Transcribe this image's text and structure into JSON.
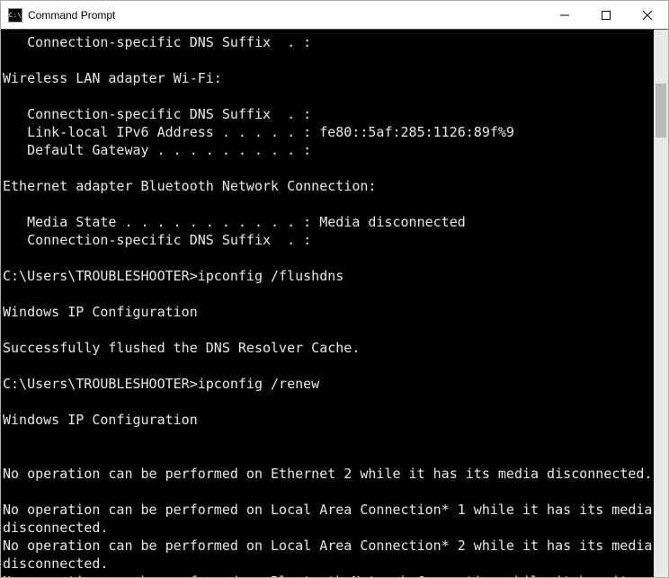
{
  "window": {
    "title": "Command Prompt",
    "icon_label": "C:\\"
  },
  "console": {
    "lines": [
      "   Connection-specific DNS Suffix  . :",
      "",
      "Wireless LAN adapter Wi-Fi:",
      "",
      "   Connection-specific DNS Suffix  . :",
      "   Link-local IPv6 Address . . . . . : fe80::5af:285:1126:89f%9",
      "   Default Gateway . . . . . . . . . :",
      "",
      "Ethernet adapter Bluetooth Network Connection:",
      "",
      "   Media State . . . . . . . . . . . : Media disconnected",
      "   Connection-specific DNS Suffix  . :",
      "",
      "C:\\Users\\TROUBLESHOOTER>ipconfig /flushdns",
      "",
      "Windows IP Configuration",
      "",
      "Successfully flushed the DNS Resolver Cache.",
      "",
      "C:\\Users\\TROUBLESHOOTER>ipconfig /renew",
      "",
      "Windows IP Configuration",
      "",
      "",
      "No operation can be performed on Ethernet 2 while it has its media disconnected.",
      "",
      "No operation can be performed on Local Area Connection* 1 while it has its media disconnected.",
      "No operation can be performed on Local Area Connection* 2 while it has its media disconnected.",
      "No operation can be performed on Bluetooth Network Connection while it has its m"
    ]
  }
}
